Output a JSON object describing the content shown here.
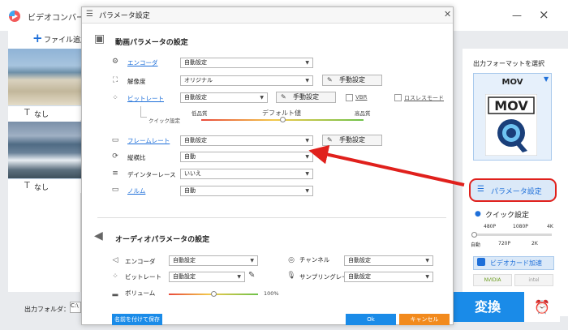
{
  "app": {
    "title": "ビデオコンバー"
  },
  "toolbar": {
    "add_file": "ファイル追加"
  },
  "files": [
    {
      "subtitle": "なし"
    },
    {
      "subtitle": "なし"
    }
  ],
  "bottom": {
    "output_folder_label": "出力フォルダ：",
    "output_folder_value": "C:\\"
  },
  "right_panel": {
    "output_format_label": "出力フォーマットを選択",
    "format_name": "MOV",
    "format_icon_text": "MOV",
    "param_button": "パラメータ設定",
    "quick_setting": "クイック設定",
    "quick_ticks_top": [
      "480P",
      "1080P",
      "4K"
    ],
    "quick_ticks_bottom": [
      "自動",
      "720P",
      "2K"
    ],
    "gpu_button": "ビデオカード加速",
    "nvidia": "NVIDIA",
    "intel": "intel",
    "convert": "変換"
  },
  "dialog": {
    "title": "パラメータ設定",
    "video_section": "動画パラメータの設定",
    "audio_section": "オーディオパラメータの設定",
    "video_rows": {
      "encoder": {
        "label": "エンコーダ",
        "value": "自動設定"
      },
      "resolution": {
        "label": "解像度",
        "value": "オリジナル",
        "manual": "手動設定"
      },
      "bitrate": {
        "label": "ビットレート",
        "value": "自動設定",
        "manual": "手動設定",
        "vbr": "VBR",
        "lossless": "ロスレスモード"
      },
      "quick": {
        "label": "クイック設定",
        "low": "低品質",
        "default": "デフォルト値",
        "high": "高品質",
        "level": 0.5
      },
      "framerate": {
        "label": "フレームレート",
        "value": "自動設定",
        "manual": "手動設定"
      },
      "aspect": {
        "label": "縦横比",
        "value": "自動"
      },
      "deinterlace": {
        "label": "デインターレース",
        "value": "いいえ"
      },
      "norm": {
        "label": "ノルム",
        "value": "自動"
      }
    },
    "audio_rows": {
      "encoder": {
        "label": "エンコーダ",
        "value": "自動設定"
      },
      "channel": {
        "label": "チャンネル",
        "value": "自動設定"
      },
      "bitrate": {
        "label": "ビットレート",
        "value": "自動設定"
      },
      "samplerate": {
        "label": "サンプリングレート",
        "value": "自動設定"
      },
      "volume": {
        "label": "ボリューム",
        "value": "100%",
        "level": 0.5
      }
    },
    "buttons": {
      "save_as": "名前を付けて保存",
      "ok": "Ok",
      "cancel": "キャンセル"
    }
  },
  "colors": {
    "accent": "#1a8be8",
    "annotation_red": "#e0201c",
    "cancel_orange": "#f28a1d"
  }
}
